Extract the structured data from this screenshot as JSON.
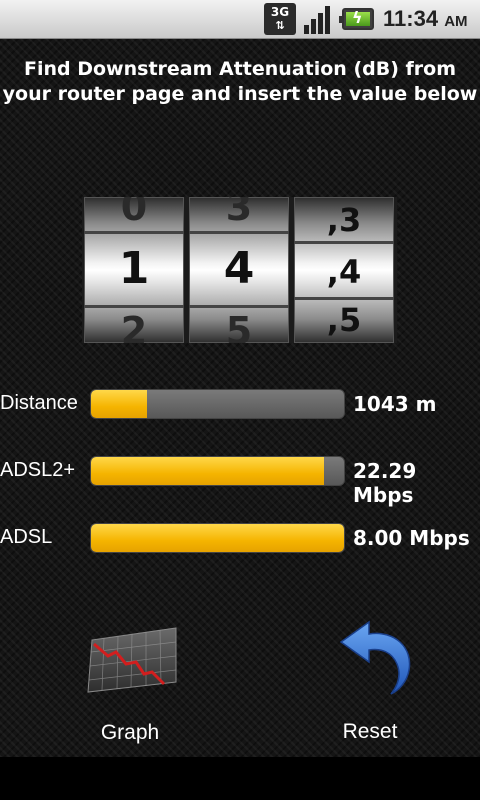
{
  "status_bar": {
    "network": "3G",
    "time": "11:34",
    "ampm": "AM"
  },
  "instruction": {
    "line1": "Find Downstream Attenuation (dB) from",
    "line2": "your router page and insert the value below"
  },
  "picker": {
    "wheels": [
      {
        "prev": "0",
        "current": "1",
        "next": "2"
      },
      {
        "prev": "3",
        "current": "4",
        "next": "5"
      },
      {
        "prev": ",3",
        "current": ",4",
        "next": ",5"
      }
    ]
  },
  "metrics": [
    {
      "label": "Distance",
      "value": "1043 m",
      "fill_fraction": 0.22
    },
    {
      "label": "ADSL2+",
      "value": "22.29 Mbps",
      "fill_fraction": 0.92
    },
    {
      "label": "ADSL",
      "value": "8.00 Mbps",
      "fill_fraction": 1.0
    }
  ],
  "buttons": {
    "graph": {
      "label": "Graph",
      "icon": "graph-icon"
    },
    "reset": {
      "label": "Reset",
      "icon": "reset-arrow-icon"
    }
  },
  "colors": {
    "bar_fill": "#f5b400",
    "bar_track": "#6a6a6a",
    "reset_blue": "#2f6fd6"
  }
}
